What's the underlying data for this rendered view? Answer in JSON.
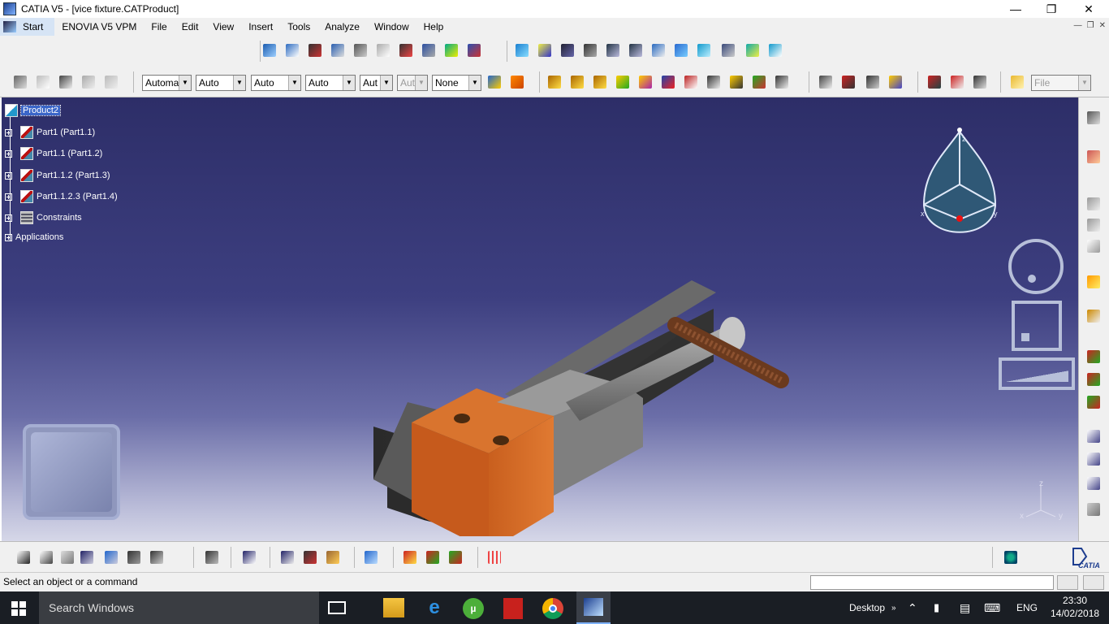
{
  "window": {
    "title": "CATIA V5 - [vice fixture.CATProduct]"
  },
  "menubar": {
    "start": "Start",
    "items": [
      "ENOVIA V5 VPM",
      "File",
      "Edit",
      "View",
      "Insert",
      "Tools",
      "Analyze",
      "Window",
      "Help"
    ]
  },
  "toolbar2": {
    "combos": [
      "Automa",
      "Auto",
      "Auto",
      "Auto",
      "Aut",
      "Aut",
      "None"
    ],
    "file_combo": "File"
  },
  "tree": {
    "root": "Product2",
    "children": [
      "Part1 (Part1.1)",
      "Part1.1 (Part1.2)",
      "Part1.1.2 (Part1.3)",
      "Part1.1.2.3 (Part1.4)",
      "Constraints"
    ],
    "applications": "Applications"
  },
  "compass": {
    "z": "z",
    "x": "x",
    "y": "y"
  },
  "axes": {
    "z": "z",
    "x": "x",
    "y": "y"
  },
  "status": {
    "message": "Select an object or a command"
  },
  "taskbar": {
    "search": "Search Windows",
    "desktop": "Desktop",
    "lang": "ENG",
    "time": "23:30",
    "date": "14/02/2018"
  },
  "colors": {
    "accent": "#3a66c8",
    "viewport_top": "#2d2e68",
    "viewport_bottom": "#d6d7e8",
    "taskbar": "#1a1e24"
  }
}
